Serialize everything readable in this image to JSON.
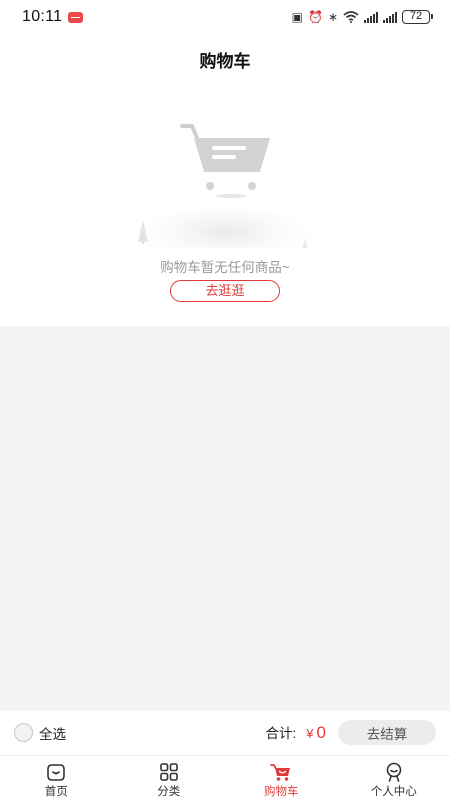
{
  "status_bar": {
    "time": "10:11",
    "battery": "72",
    "icons": [
      "nfc-icon",
      "alarm-icon",
      "bluetooth-icon",
      "wifi-icon",
      "signal-icon",
      "signal-icon",
      "battery-icon"
    ]
  },
  "header": {
    "title": "购物车"
  },
  "empty_state": {
    "illustration": "empty-cart-icon",
    "message": "购物车暂无任何商品~",
    "button_label": "去逛逛"
  },
  "checkout_bar": {
    "select_all_label": "全选",
    "total_label": "合计:",
    "currency": "¥",
    "total_value": "0",
    "checkout_label": "去结算"
  },
  "tab_bar": {
    "items": [
      {
        "label": "首页",
        "icon": "home-icon",
        "active": false
      },
      {
        "label": "分类",
        "icon": "category-icon",
        "active": false
      },
      {
        "label": "购物车",
        "icon": "cart-icon",
        "active": true
      },
      {
        "label": "个人中心",
        "icon": "profile-icon",
        "active": false
      }
    ]
  },
  "colors": {
    "accent": "#e33b3b",
    "background": "#f4f4f4",
    "inactive_button": "#ececec"
  }
}
